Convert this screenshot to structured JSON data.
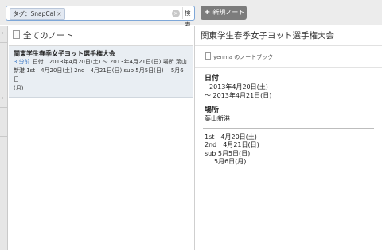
{
  "search": {
    "tag_label": "タグ：SnapCal",
    "tag_remove": "×",
    "clear": "×",
    "button": "検索"
  },
  "toolbar": {
    "new_note_plus": "+",
    "new_note_label": "新規ノート"
  },
  "sidebar": {
    "arrow_top": "▸",
    "arrow_mid": "▸"
  },
  "list": {
    "header": "全てのノート",
    "notes": [
      {
        "title": "関東学生春季女子ヨット選手権大会",
        "age": "3 分前",
        "snippet_1": "日付　2013年4月20日(土) ～ 2013年4月21日(日) 場所 葉山",
        "snippet_2": "新港 1st　4月20日(土) 2nd　4月21日(日) sub 5月5日(日)　 5月6日",
        "snippet_3": "(月)"
      }
    ]
  },
  "detail": {
    "title": "関東学生春季女子ヨット選手権大会",
    "notebook": "yenma のノートブック",
    "date_label": "日付",
    "date_line1": "2013年4月20日(土)",
    "date_line2": "～ 2013年4月21日(日)",
    "place_label": "場所",
    "place_value": "葉山新港",
    "schedule": [
      "1st　4月20日(土)",
      "2nd　4月21日(日)",
      "sub 5月5日(日)",
      "5月6日(月)"
    ]
  }
}
